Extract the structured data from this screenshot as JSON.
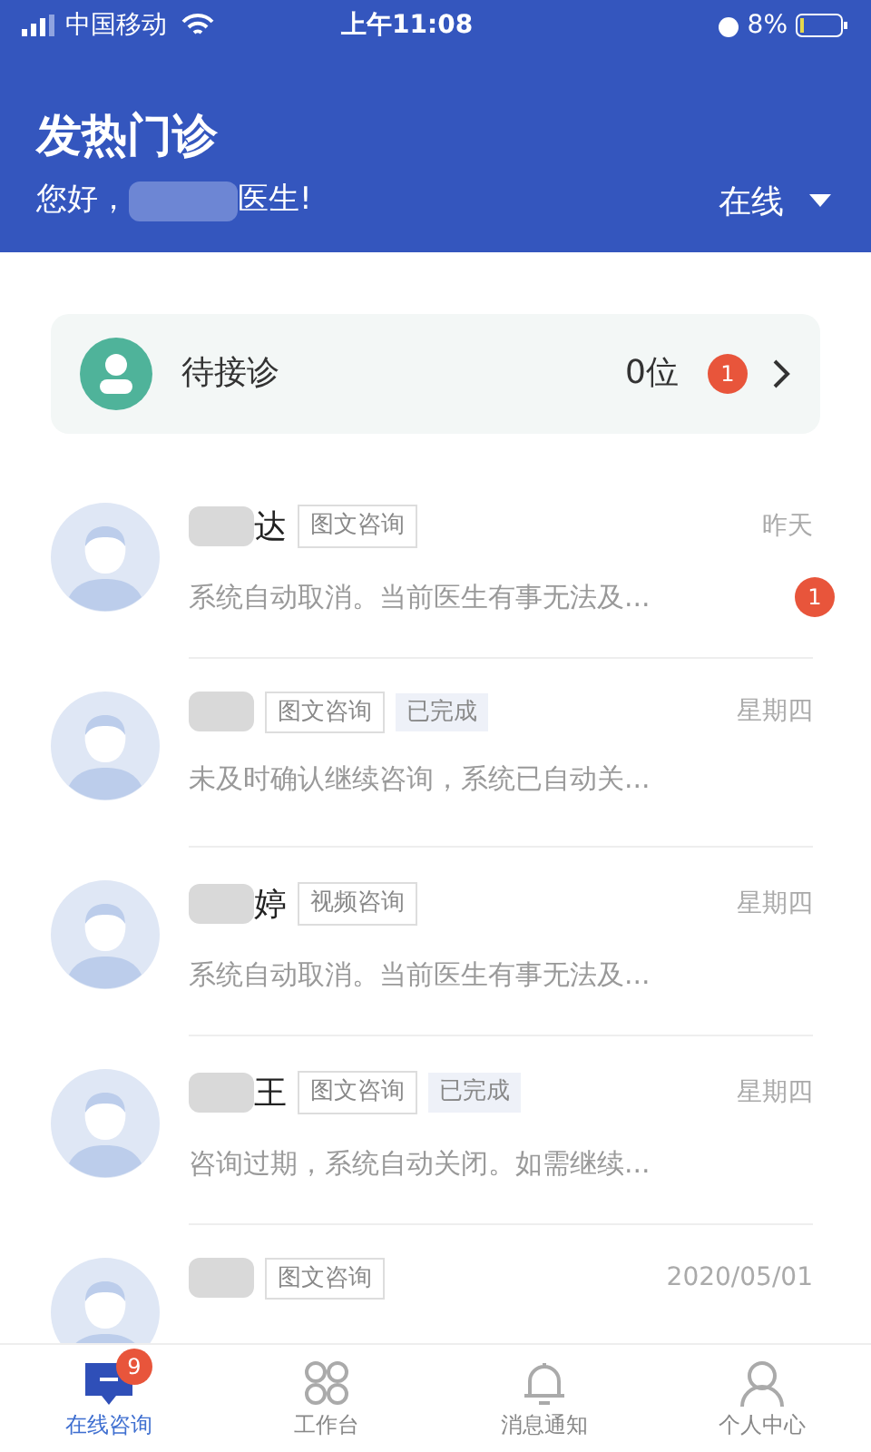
{
  "status_bar": {
    "carrier": "中国移动",
    "time": "上午11:08",
    "battery": "8%"
  },
  "header": {
    "title": "发热门诊",
    "greeting_start": "您好，",
    "greeting_end": "医生!",
    "status": "在线"
  },
  "waiting": {
    "label": "待接诊",
    "count": "0位",
    "badge": "1"
  },
  "consultations": [
    {
      "name_visible": "达",
      "tags": [
        {
          "text": "图文咨询",
          "kind": "outline"
        }
      ],
      "time": "昨天",
      "preview": "系统自动取消。当前医生有事无法及...",
      "unread": "1"
    },
    {
      "tags": [
        {
          "text": "图文咨询",
          "kind": "outline"
        },
        {
          "text": "已完成",
          "kind": "filled"
        }
      ],
      "time": "星期四",
      "preview": "未及时确认继续咨询，系统已自动关..."
    },
    {
      "name_visible": "婷",
      "tags": [
        {
          "text": "视频咨询",
          "kind": "outline"
        }
      ],
      "time": "星期四",
      "preview": "系统自动取消。当前医生有事无法及..."
    },
    {
      "name_visible": "王",
      "tags": [
        {
          "text": "图文咨询",
          "kind": "outline"
        },
        {
          "text": "已完成",
          "kind": "filled"
        }
      ],
      "time": "星期四",
      "preview": "咨询过期，系统自动关闭。如需继续..."
    },
    {
      "tags": [
        {
          "text": "图文咨询",
          "kind": "outline"
        }
      ],
      "time": "2020/05/01"
    }
  ],
  "tab_bar": [
    {
      "label": "在线咨询",
      "kind": "chat",
      "selected": true,
      "badge": "9"
    },
    {
      "label": "工作台",
      "kind": "grid",
      "selected": false
    },
    {
      "label": "消息通知",
      "kind": "bell",
      "selected": false
    },
    {
      "label": "个人中心",
      "kind": "person",
      "selected": false
    }
  ]
}
